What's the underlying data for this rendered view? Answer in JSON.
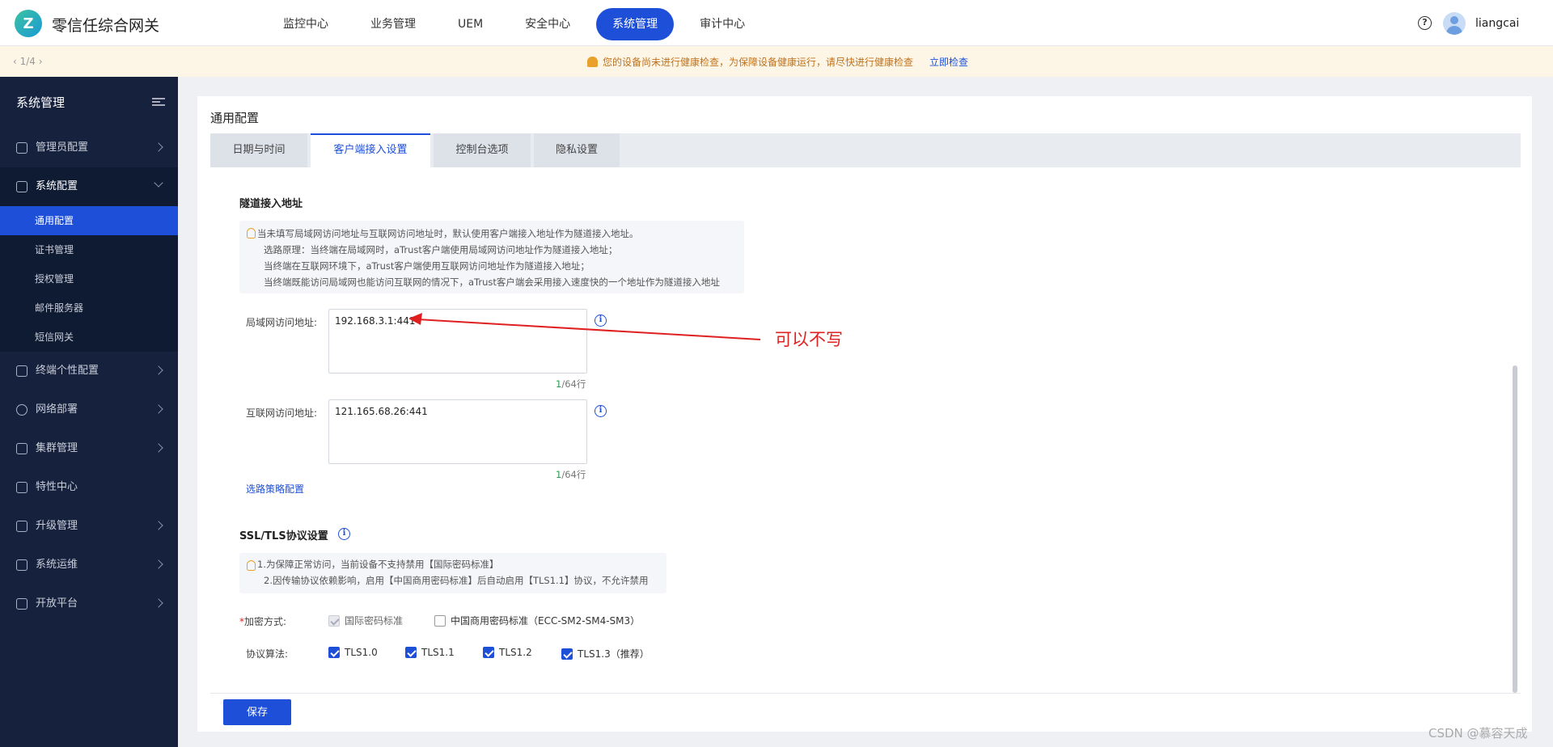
{
  "header": {
    "brand": "零信任综合网关",
    "nav": [
      "监控中心",
      "业务管理",
      "UEM",
      "安全中心",
      "系统管理",
      "审计中心"
    ],
    "help_glyph": "?",
    "username": "liangcai"
  },
  "notice": {
    "pager": "‹ 1/4 ›",
    "text": "您的设备尚未进行健康检查，为保障设备健康运行，请尽快进行健康检查",
    "link": "立即检查"
  },
  "sidebar": {
    "title": "系统管理",
    "items": [
      {
        "label": "管理员配置",
        "icon": "user-icon"
      },
      {
        "label": "系统配置",
        "icon": "gear-icon"
      },
      {
        "label": "终端个性配置",
        "icon": "device-icon"
      },
      {
        "label": "网络部署",
        "icon": "globe-icon"
      },
      {
        "label": "集群管理",
        "icon": "cluster-icon"
      },
      {
        "label": "特性中心",
        "icon": "grid-icon"
      },
      {
        "label": "升级管理",
        "icon": "upload-icon"
      },
      {
        "label": "系统运维",
        "icon": "monitor-icon"
      },
      {
        "label": "开放平台",
        "icon": "platform-icon"
      }
    ],
    "sub_items": [
      "通用配置",
      "证书管理",
      "授权管理",
      "邮件服务器",
      "短信网关"
    ]
  },
  "content": {
    "title": "通用配置",
    "tabs": [
      "日期与时间",
      "客户端接入设置",
      "控制台选项",
      "隐私设置"
    ],
    "tunnel": {
      "heading": "隧道接入地址",
      "tips": [
        "当未填写局域网访问地址与互联网访问地址时，默认使用客户端接入地址作为隧道接入地址。",
        "选路原理：当终端在局域网时，aTrust客户端使用局域网访问地址作为隧道接入地址；",
        "当终端在互联网环境下，aTrust客户端使用互联网访问地址作为隧道接入地址；",
        "当终端既能访问局域网也能访问互联网的情况下，aTrust客户端会采用接入速度快的一个地址作为隧道接入地址"
      ],
      "lan_label": "局域网访问地址:",
      "lan_value": "192.168.3.1:441",
      "lan_count_cur": "1",
      "lan_count_max": "/64行",
      "wan_label": "互联网访问地址:",
      "wan_value": "121.165.68.26:441",
      "wan_count_cur": "1",
      "wan_count_max": "/64行",
      "route_link": "选路策略配置",
      "annotation": "可以不写"
    },
    "ssl": {
      "heading": "SSL/TLS协议设置",
      "tips": [
        "1.为保障正常访问，当前设备不支持禁用【国际密码标准】",
        "2.因传输协议依赖影响，启用【中国商用密码标准】后自动启用【TLS1.1】协议，不允许禁用"
      ],
      "encrypt_label": "加密方式:",
      "encrypt_options": [
        "国际密码标准",
        "中国商用密码标准（ECC-SM2-SM4-SM3）"
      ],
      "protocol_label": "协议算法:",
      "protocols": [
        "TLS1.0",
        "TLS1.1",
        "TLS1.2",
        "TLS1.3（推荐）"
      ]
    },
    "save_label": "保存"
  },
  "watermark": "CSDN @慕容天成"
}
